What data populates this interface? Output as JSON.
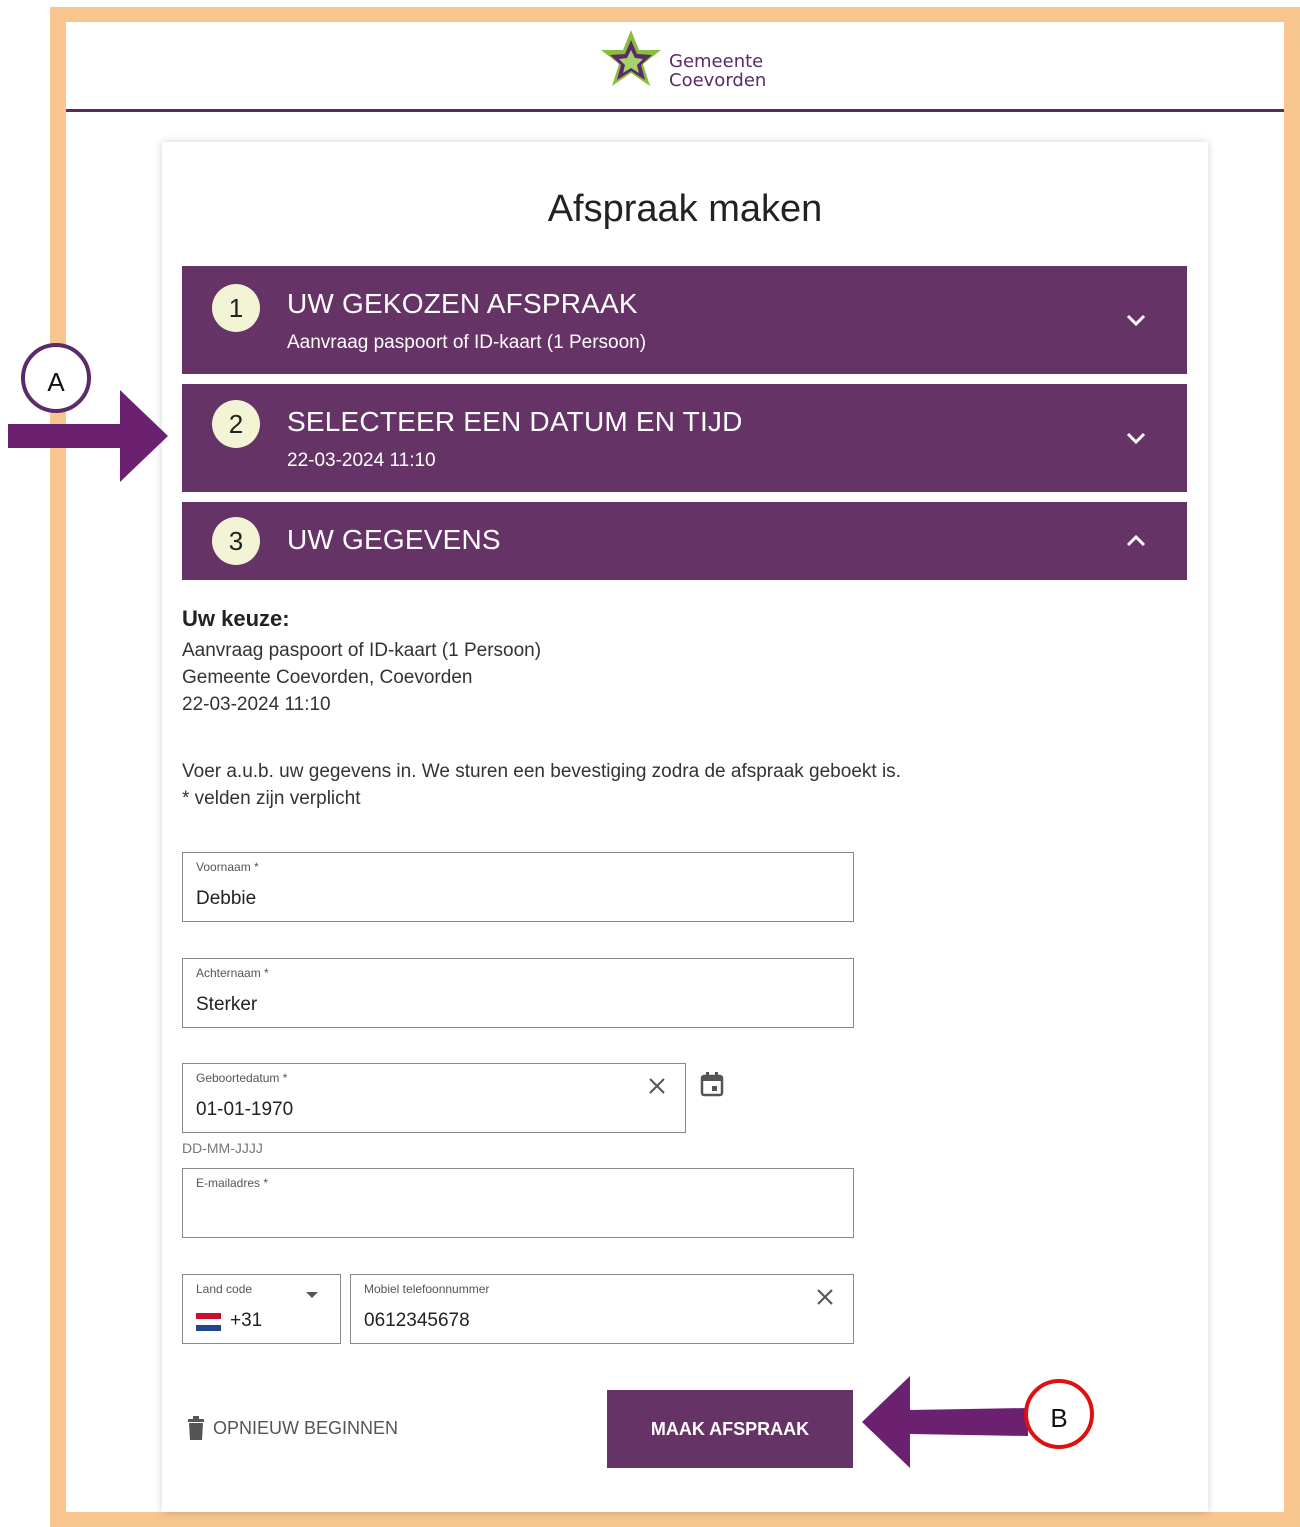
{
  "header": {
    "logo_line1": "Gemeente",
    "logo_line2": "Coevorden"
  },
  "page_title": "Afspraak maken",
  "steps": [
    {
      "number": "1",
      "title": "UW GEKOZEN AFSPRAAK",
      "subtitle": "Aanvraag paspoort of ID-kaart (1 Persoon)",
      "icon": "chevron-down-icon"
    },
    {
      "number": "2",
      "title": "SELECTEER EEN DATUM EN TIJD",
      "subtitle": "22-03-2024 11:10",
      "icon": "chevron-down-icon"
    },
    {
      "number": "3",
      "title": "UW GEGEVENS",
      "subtitle": "",
      "icon": "chevron-up-icon"
    }
  ],
  "summary": {
    "heading": "Uw keuze:",
    "lines": [
      "Aanvraag paspoort of ID-kaart (1 Persoon)",
      "Gemeente Coevorden, Coevorden",
      "22-03-2024 11:10"
    ]
  },
  "instructions": {
    "text": "Voer a.u.b. uw gegevens in. We sturen een bevestiging zodra de afspraak geboekt is.",
    "required_note": "* velden zijn verplicht"
  },
  "form": {
    "first_name": {
      "label": "Voornaam *",
      "value": "Debbie"
    },
    "last_name": {
      "label": "Achternaam *",
      "value": "Sterker"
    },
    "birthdate": {
      "label": "Geboortedatum *",
      "value": "01-01-1970",
      "hint": "DD-MM-JJJJ"
    },
    "email": {
      "label": "E-mailadres *",
      "value": ""
    },
    "country_code": {
      "label": "Land code",
      "value": "+31"
    },
    "phone": {
      "label": "Mobiel telefoonnummer",
      "value": "0612345678"
    }
  },
  "actions": {
    "reset_label": "OPNIEUW BEGINNEN",
    "submit_label": "MAAK AFSPRAAK"
  },
  "annotations": {
    "a_label": "A",
    "b_label": "B"
  },
  "colors": {
    "primary": "#663366",
    "frame": "#f7c68e",
    "marker_a": "#5a2a6a",
    "marker_b": "#e01010",
    "arrow": "#6b2070"
  }
}
